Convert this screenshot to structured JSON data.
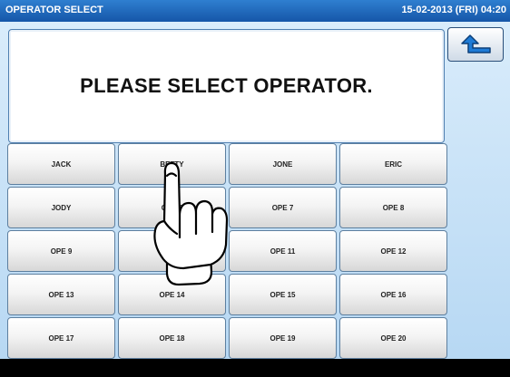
{
  "titlebar": {
    "title": "OPERATOR SELECT",
    "datetime": "15-02-2013 (FRI) 04:20"
  },
  "message": "PLEASE SELECT OPERATOR.",
  "icons": {
    "back": "return-arrow-icon",
    "hand": "pointing-hand-icon"
  },
  "operators": [
    "JACK",
    "BETTY",
    "JONE",
    "ERIC",
    "JODY",
    "OPE 6",
    "OPE 7",
    "OPE 8",
    "OPE 9",
    "OPE 10",
    "OPE 11",
    "OPE 12",
    "OPE 13",
    "OPE 14",
    "OPE 15",
    "OPE 16",
    "OPE 17",
    "OPE 18",
    "OPE 19",
    "OPE 20"
  ]
}
